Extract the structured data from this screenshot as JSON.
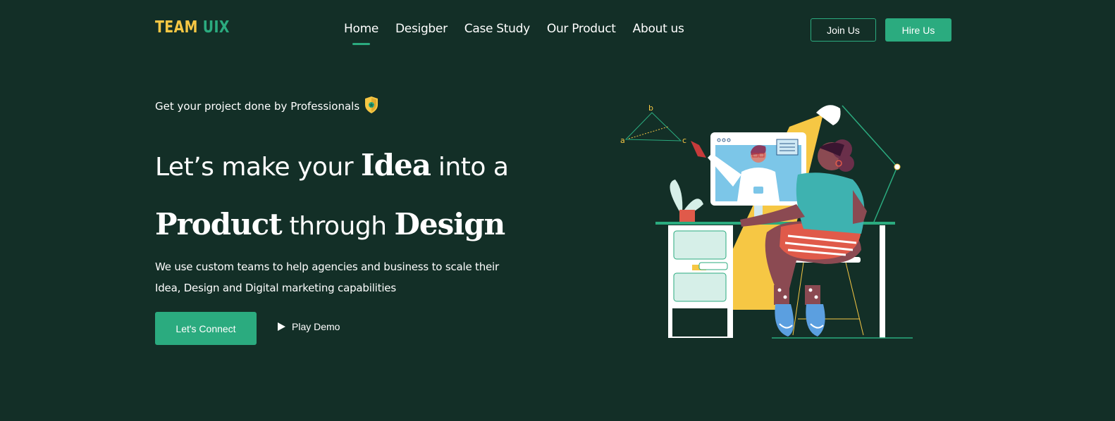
{
  "brand": {
    "part1": "TEAM",
    "part2": "UIX"
  },
  "nav": {
    "items": [
      {
        "label": "Home",
        "active": true
      },
      {
        "label": "Desigber",
        "active": false
      },
      {
        "label": "Case Study",
        "active": false
      },
      {
        "label": "Our Product",
        "active": false
      },
      {
        "label": "About us",
        "active": false
      }
    ]
  },
  "header": {
    "join_label": "Join Us",
    "hire_label": "Hire Us"
  },
  "hero": {
    "tagline": "Get your project done by Professionals",
    "headline": {
      "line1_a": "Let’s make your ",
      "line1_b": "Idea",
      "line1_c": " into a",
      "line2_a": "Product",
      "line2_b": " through ",
      "line2_c": "Design"
    },
    "description": "We use custom teams to help agencies and business to scale their Idea, Design and Digital marketing capabilities",
    "connect_label": "Let's Connect",
    "demo_label": "Play Demo"
  },
  "illustration": {
    "label_a": "a",
    "label_b": "b",
    "label_c": "c"
  },
  "colors": {
    "background": "#132f27",
    "accent": "#2bab7f",
    "brand_yellow": "#f6c744"
  },
  "icons": {
    "badge": "shield-badge-icon",
    "play": "play-icon"
  }
}
